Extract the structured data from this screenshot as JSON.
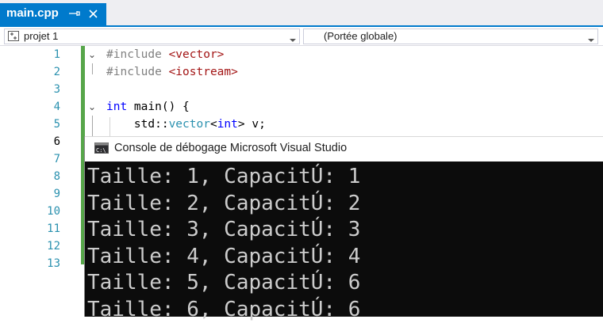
{
  "tab": {
    "title": "main.cpp"
  },
  "navbar": {
    "project": "projet 1",
    "scope": "(Portée globale)"
  },
  "editor": {
    "line_numbers": [
      "1",
      "2",
      "3",
      "4",
      "5",
      "6",
      "7",
      "8",
      "9",
      "10",
      "11",
      "12",
      "13"
    ],
    "current_line": "6",
    "code_lines": [
      {
        "tokens": [
          {
            "c": "tok-pre",
            "t": "#include "
          },
          {
            "c": "tok-inc",
            "t": "<vector>"
          }
        ]
      },
      {
        "tokens": [
          {
            "c": "tok-pre",
            "t": "#include "
          },
          {
            "c": "tok-inc",
            "t": "<iostream>"
          }
        ]
      },
      {
        "tokens": []
      },
      {
        "tokens": [
          {
            "c": "tok-kw",
            "t": "int"
          },
          {
            "c": "tok-txt",
            "t": " main() {"
          }
        ]
      },
      {
        "tokens": [
          {
            "c": "tok-txt",
            "t": "    std::"
          },
          {
            "c": "tok-type",
            "t": "vector"
          },
          {
            "c": "tok-txt",
            "t": "<"
          },
          {
            "c": "tok-kw",
            "t": "int"
          },
          {
            "c": "tok-txt",
            "t": "> v;"
          }
        ]
      }
    ]
  },
  "console": {
    "title": "Console de débogage Microsoft Visual Studio",
    "output": [
      "Taille: 1, CapacitÚ: 1",
      "Taille: 2, CapacitÚ: 2",
      "Taille: 3, CapacitÚ: 3",
      "Taille: 4, CapacitÚ: 4",
      "Taille: 5, CapacitÚ: 6",
      "Taille: 6, CapacitÚ: 6"
    ]
  },
  "colors": {
    "accent": "#007acc",
    "change_bar": "#57a64a",
    "line_number": "#2b91af",
    "console_bg": "#0c0c0c",
    "console_text": "#cccccc"
  }
}
